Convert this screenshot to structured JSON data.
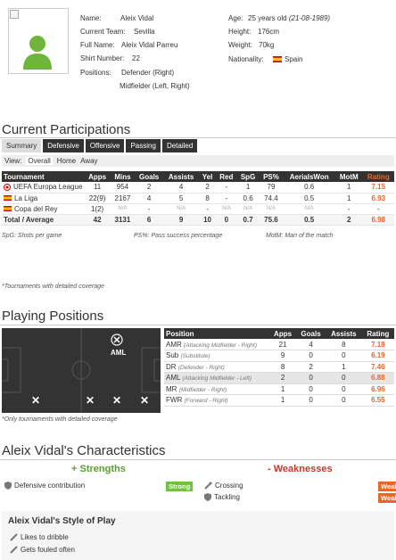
{
  "profile": {
    "name_label": "Name:",
    "name": "Aleix Vidal",
    "team_label": "Current Team:",
    "team": "Sevilla",
    "fullname_label": "Full Name:",
    "fullname": "Aleix Vidal Parreu",
    "shirt_label": "Shirt Number:",
    "shirt": "22",
    "positions_label": "Positions:",
    "positions_1": "Defender (Right)",
    "positions_2": "Midfielder (Left, Right)",
    "age_label": "Age:",
    "age": "25 years old",
    "age_dob": "(21-08-1989)",
    "height_label": "Height:",
    "height": "176cm",
    "weight_label": "Weight:",
    "weight": "70kg",
    "nationality_label": "Nationality:",
    "nationality": "Spain"
  },
  "participations": {
    "title": "Current Participations",
    "tabs": [
      "Summary",
      "Defensive",
      "Offensive",
      "Passing",
      "Detailed"
    ],
    "view_label": "View:",
    "views": [
      "Overall",
      "Home",
      "Away"
    ],
    "headers": [
      "Tournament",
      "Apps",
      "Mins",
      "Goals",
      "Assists",
      "Yel",
      "Red",
      "SpG",
      "PS%",
      "AerialsWon",
      "MotM",
      "Rating"
    ],
    "rows": [
      [
        "UEFA Europa League",
        "11",
        "954",
        "2",
        "4",
        "2",
        "-",
        "1",
        "79",
        "0.6",
        "1",
        "7.15"
      ],
      [
        "La Liga",
        "22(9)",
        "2167",
        "4",
        "5",
        "8",
        "-",
        "0.6",
        "74.4",
        "0.5",
        "1",
        "6.93"
      ],
      [
        "Copa del Rey",
        "1(2)",
        "N/A",
        "-",
        "N/A",
        "-",
        "N/A",
        "N/A",
        "N/A",
        "N/A",
        "-",
        "-"
      ]
    ],
    "total": [
      "Total / Average",
      "42",
      "3131",
      "6",
      "9",
      "10",
      "0",
      "0.7",
      "75.6",
      "0.5",
      "2",
      "6.98"
    ],
    "legend": [
      "SpG: Shots per game",
      "PS%: Pass success percentage",
      "MotM: Man of the match"
    ],
    "note": "*Tournaments with detailed coverage"
  },
  "positions": {
    "title": "Playing Positions",
    "pitch_active_label": "AML",
    "headers": [
      "Position",
      "Apps",
      "Goals",
      "Assists",
      "Rating"
    ],
    "rows": [
      {
        "code": "AMR",
        "desc": "(Attacking Midfielder - Right)",
        "apps": "21",
        "goals": "4",
        "assists": "8",
        "rating": "7.18"
      },
      {
        "code": "Sub",
        "desc": "(Substitute)",
        "apps": "9",
        "goals": "0",
        "assists": "0",
        "rating": "6.19"
      },
      {
        "code": "DR",
        "desc": "(Defender - Right)",
        "apps": "8",
        "goals": "2",
        "assists": "1",
        "rating": "7.46"
      },
      {
        "code": "AML",
        "desc": "(Attacking Midfielder - Left)",
        "apps": "2",
        "goals": "0",
        "assists": "0",
        "rating": "6.88"
      },
      {
        "code": "MR",
        "desc": "(Midfielder - Right)",
        "apps": "1",
        "goals": "0",
        "assists": "0",
        "rating": "6.96"
      },
      {
        "code": "FWR",
        "desc": "(Forward - Right)",
        "apps": "1",
        "goals": "0",
        "assists": "0",
        "rating": "6.55"
      }
    ],
    "note": "*Only tournaments with detailed coverage"
  },
  "characteristics": {
    "title": "Aleix Vidal's Characteristics",
    "strengths_title": "+ Strengths",
    "weaknesses_title": "- Weaknesses",
    "strengths": [
      {
        "label": "Defensive contribution",
        "level": "Strong"
      }
    ],
    "weaknesses": [
      {
        "label": "Crossing",
        "level": "Weak"
      },
      {
        "label": "Tackling",
        "level": "Weak"
      }
    ],
    "style_title": "Aleix Vidal's Style of Play",
    "style": [
      "Likes to dribble",
      "Gets fouled often"
    ]
  },
  "colors": {
    "accent": "#e8672c",
    "strong": "#6fc43b",
    "dark": "#333333"
  }
}
